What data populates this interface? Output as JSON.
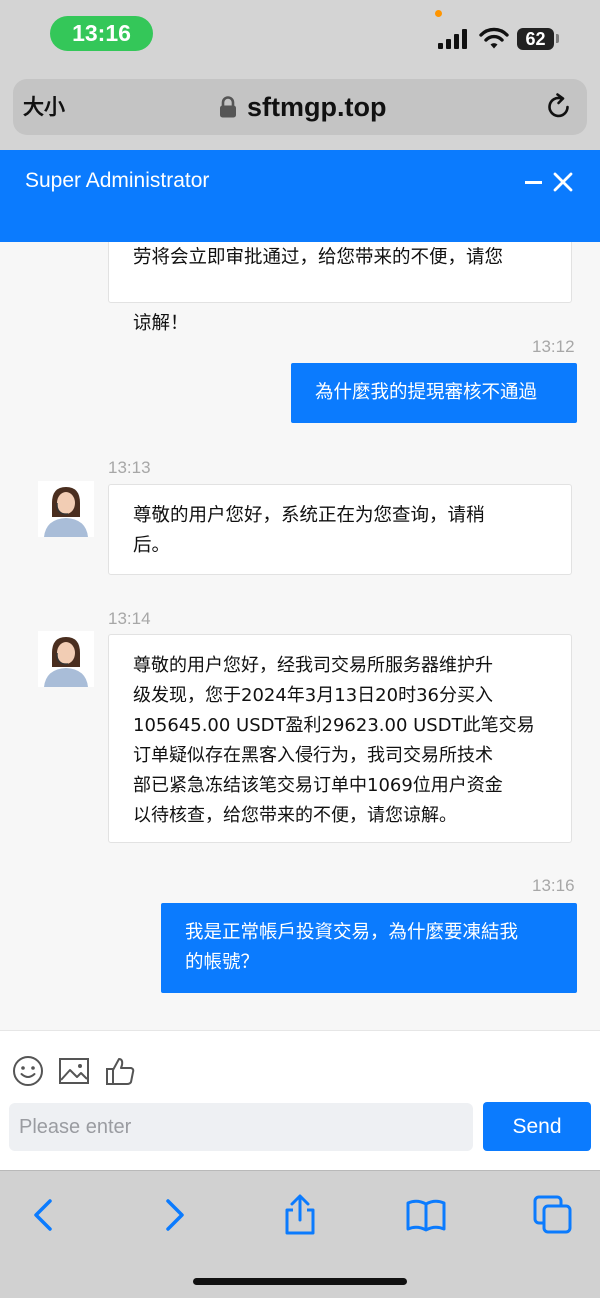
{
  "status_bar": {
    "time": "13:16",
    "battery": "62"
  },
  "browser": {
    "text_size_label": "大小",
    "url": "sftmgp.top"
  },
  "chat": {
    "title": "Super Administrator",
    "partial_message_top": "劳将会立即审批通过，给您带来的不便，请您",
    "partial_message_bottom": "谅解！",
    "messages": [
      {
        "time": "13:12",
        "direction": "out",
        "text": "為什麼我的提現審核不通過"
      },
      {
        "time": "13:13",
        "direction": "in",
        "text": "尊敬的用户您好，系统正在为您查询，请稍\n后。"
      },
      {
        "time": "13:14",
        "direction": "in",
        "text": "尊敬的用户您好，经我司交易所服务器维护升\n级发现，您于2024年3月13日20时36分买入\n105645.00 USDT盈利29623.00 USDT此笔交易\n订单疑似存在黑客入侵行为，我司交易所技术\n部已紧急冻结该笔交易订单中1069位用户资金\n以待核查，给您带来的不便，请您谅解。"
      },
      {
        "time": "13:16",
        "direction": "out",
        "text": "我是正常帳戶投資交易，為什麼要凍結我\n的帳號？"
      }
    ]
  },
  "composer": {
    "input_value": "",
    "placeholder": "Please enter",
    "send_label": "Send",
    "tools": [
      "emoji-icon",
      "image-icon",
      "thumbs-up-icon"
    ]
  },
  "toolbar": {
    "icons": [
      "back-icon",
      "forward-icon",
      "share-icon",
      "bookmarks-icon",
      "tabs-icon"
    ]
  },
  "colors": {
    "accent": "#0b7bfe",
    "status_pill": "#34c759"
  }
}
